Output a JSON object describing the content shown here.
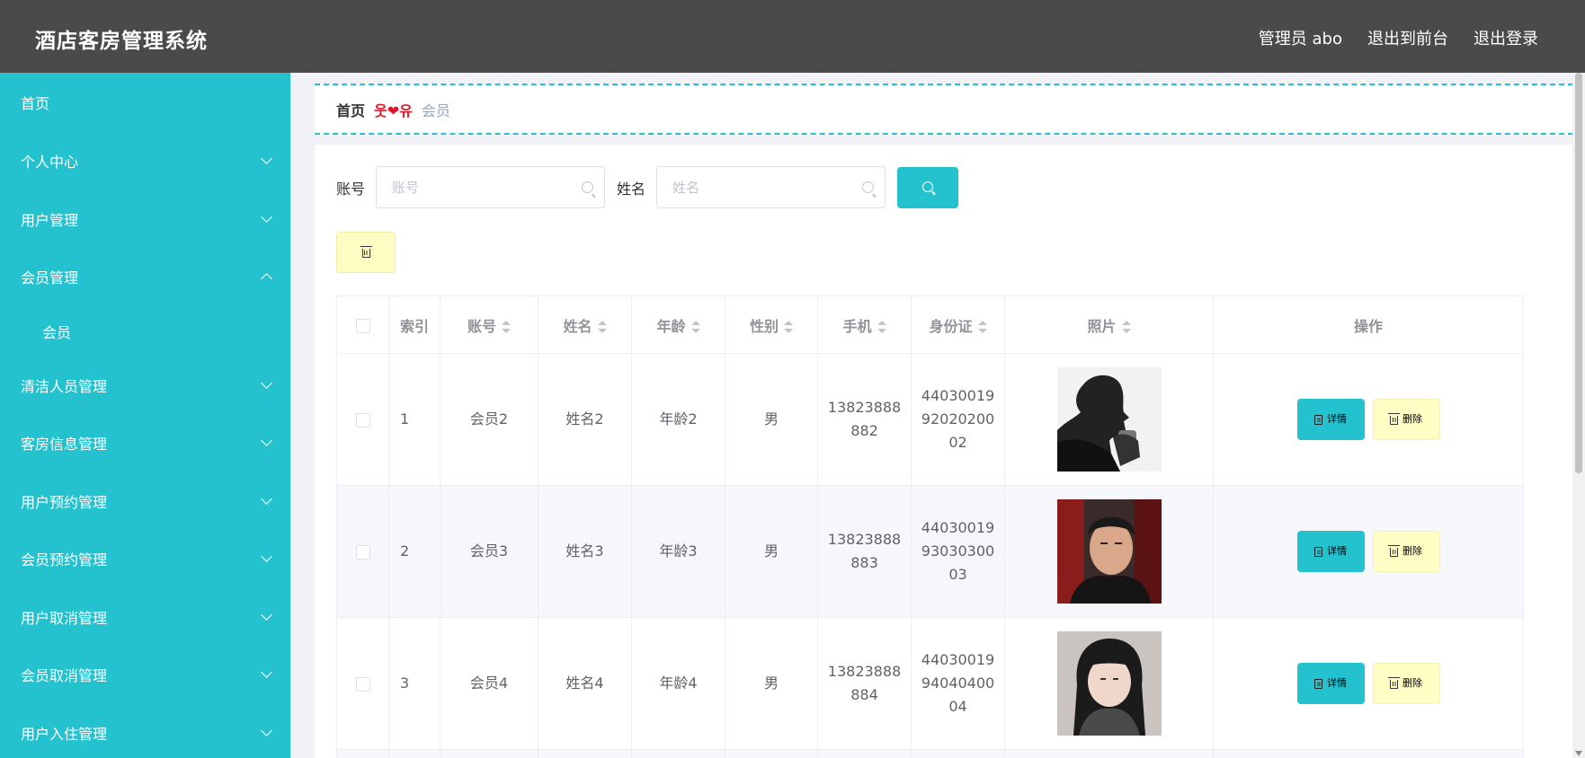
{
  "header": {
    "title": "酒店客房管理系统",
    "links": [
      "管理员 abo",
      "退出到前台",
      "退出登录"
    ]
  },
  "sidebar": {
    "items": [
      {
        "label": "首页",
        "expandable": false
      },
      {
        "label": "个人中心",
        "expandable": true
      },
      {
        "label": "用户管理",
        "expandable": true
      },
      {
        "label": "会员管理",
        "expandable": true,
        "expanded": true
      },
      {
        "label": "会员",
        "sub": true
      },
      {
        "label": "清洁人员管理",
        "expandable": true
      },
      {
        "label": "客房信息管理",
        "expandable": true
      },
      {
        "label": "用户预约管理",
        "expandable": true
      },
      {
        "label": "会员预约管理",
        "expandable": true
      },
      {
        "label": "用户取消管理",
        "expandable": true
      },
      {
        "label": "会员取消管理",
        "expandable": true
      },
      {
        "label": "用户入住管理",
        "expandable": true
      }
    ]
  },
  "breadcrumb": {
    "home": "首页",
    "separator": "웃❤유",
    "current": "会员"
  },
  "search": {
    "account_label": "账号",
    "account_placeholder": "账号",
    "name_label": "姓名",
    "name_placeholder": "姓名"
  },
  "table": {
    "columns": [
      "索引",
      "账号",
      "姓名",
      "年龄",
      "性别",
      "手机",
      "身份证",
      "照片",
      "操作"
    ],
    "rows": [
      {
        "index": "1",
        "account": "会员2",
        "name": "姓名2",
        "age": "年龄2",
        "gender": "男",
        "phone": "13823888882",
        "id_card": "440300199202020002",
        "photo": "man-silhouette-photo"
      },
      {
        "index": "2",
        "account": "会员3",
        "name": "姓名3",
        "age": "年龄3",
        "gender": "男",
        "phone": "13823888883",
        "id_card": "440300199303030003",
        "photo": "man-portrait-photo"
      },
      {
        "index": "3",
        "account": "会员4",
        "name": "姓名4",
        "age": "年龄4",
        "gender": "男",
        "phone": "13823888884",
        "id_card": "440300199404040004",
        "photo": "woman-portrait-photo"
      }
    ],
    "detail_label": "详情",
    "delete_label": "删除"
  },
  "colors": {
    "accent": "#24c1cf",
    "header_bg": "#4a4a4a",
    "delete_bg": "#fffdc4",
    "separator": "#e0162b"
  }
}
